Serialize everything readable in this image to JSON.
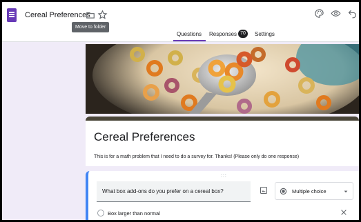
{
  "header": {
    "doc_title": "Cereal Preferences",
    "tooltip": "Move to folder"
  },
  "tabs": {
    "questions": "Questions",
    "responses": "Responses",
    "responses_count": "70",
    "settings": "Settings"
  },
  "form": {
    "title": "Cereal Preferences",
    "description": "This is for a math problem that I need to do a survey for. Thanks! (Please only do one response)"
  },
  "question": {
    "drag_handle": ":::",
    "text": "What box add-ons do you prefer on a cereal box?",
    "type": "Multiple choice",
    "options": [
      "Box larger than normal"
    ]
  },
  "colors": {
    "accent": "#673ab7",
    "background": "#f0ebf8",
    "question_border": "#4285f4",
    "header_band": "#4a4538"
  },
  "icons": [
    "forms-logo-icon",
    "folder-icon",
    "star-icon",
    "palette-icon",
    "eye-icon",
    "undo-icon",
    "image-icon",
    "radio-icon",
    "dropdown-icon",
    "close-icon"
  ]
}
